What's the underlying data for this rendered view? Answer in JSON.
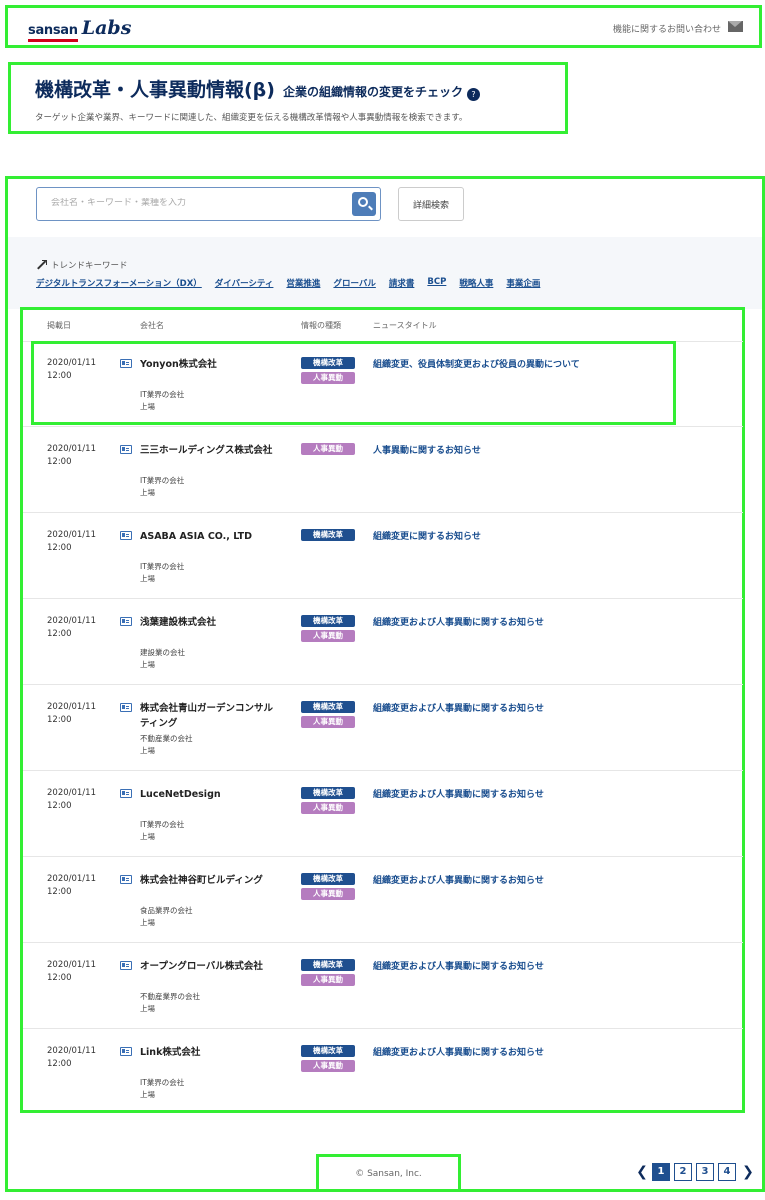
{
  "header": {
    "logo_main": "sansan",
    "logo_sub": "Labs",
    "contact_label": "機能に関するお問い合わせ"
  },
  "title": {
    "main": "機構改革・人事異動情報(β)",
    "sub": "企業の組織情報の変更をチェック",
    "help": "?",
    "description": "ターゲット企業や業界、キーワードに関連した、組織変更を伝える機構改革情報や人事異動情報を検索できます。"
  },
  "search": {
    "placeholder": "会社名・キーワード・業種を入力",
    "advanced_label": "詳細検索"
  },
  "trend": {
    "heading": "トレンドキーワード",
    "keywords": [
      "デジタルトランスフォーメーション（DX）",
      "ダイバーシティ",
      "営業推進",
      "グローバル",
      "請求書",
      "BCP",
      "戦略人事",
      "事業企画"
    ]
  },
  "table": {
    "headers": {
      "date": "掲載日",
      "company": "会社名",
      "type": "情報の種類",
      "news": "ニュースタイトル"
    },
    "tags": {
      "org": "機構改革",
      "hr": "人事異動"
    },
    "rows": [
      {
        "date": "2020/01/11",
        "time": "12:00",
        "company": "Yonyon株式会社",
        "industry": "IT業界の会社",
        "listed": "上場",
        "tag1": "機構改革",
        "tag2": "人事異動",
        "news": "組織変更、役員体制変更および役員の異動について"
      },
      {
        "date": "2020/01/11",
        "time": "12:00",
        "company": "三三ホールディングス株式会社",
        "industry": "IT業界の会社",
        "listed": "上場",
        "tag1": "人事異動",
        "tag2": "",
        "news": "人事異動に関するお知らせ"
      },
      {
        "date": "2020/01/11",
        "time": "12:00",
        "company": "ASABA ASIA CO., LTD",
        "industry": "IT業界の会社",
        "listed": "上場",
        "tag1": "機構改革",
        "tag2": "",
        "news": "組織変更に関するお知らせ"
      },
      {
        "date": "2020/01/11",
        "time": "12:00",
        "company": "浅葉建設株式会社",
        "industry": "建設業の会社",
        "listed": "上場",
        "tag1": "機構改革",
        "tag2": "人事異動",
        "news": "組織変更および人事異動に関するお知らせ"
      },
      {
        "date": "2020/01/11",
        "time": "12:00",
        "company": "株式会社青山ガーデンコンサルティング",
        "industry": "不動産業の会社",
        "listed": "上場",
        "tag1": "機構改革",
        "tag2": "人事異動",
        "news": "組織変更および人事異動に関するお知らせ"
      },
      {
        "date": "2020/01/11",
        "time": "12:00",
        "company": "LuceNetDesign",
        "industry": "IT業界の会社",
        "listed": "上場",
        "tag1": "機構改革",
        "tag2": "人事異動",
        "news": "組織変更および人事異動に関するお知らせ"
      },
      {
        "date": "2020/01/11",
        "time": "12:00",
        "company": "株式会社神谷町ビルディング",
        "industry": "食品業界の会社",
        "listed": "上場",
        "tag1": "機構改革",
        "tag2": "人事異動",
        "news": "組織変更および人事異動に関するお知らせ"
      },
      {
        "date": "2020/01/11",
        "time": "12:00",
        "company": "オープングローバル株式会社",
        "industry": "不動産業界の会社",
        "listed": "上場",
        "tag1": "機構改革",
        "tag2": "人事異動",
        "news": "組織変更および人事異動に関するお知らせ"
      },
      {
        "date": "2020/01/11",
        "time": "12:00",
        "company": "Link株式会社",
        "industry": "IT業界の会社",
        "listed": "上場",
        "tag1": "機構改革",
        "tag2": "人事異動",
        "news": "組織変更および人事異動に関するお知らせ"
      }
    ]
  },
  "footer": {
    "copyright": "© Sansan, Inc."
  },
  "pagination": {
    "prev": "❮",
    "next": "❯",
    "pages": [
      "1",
      "2",
      "3",
      "4"
    ],
    "current": "1"
  }
}
